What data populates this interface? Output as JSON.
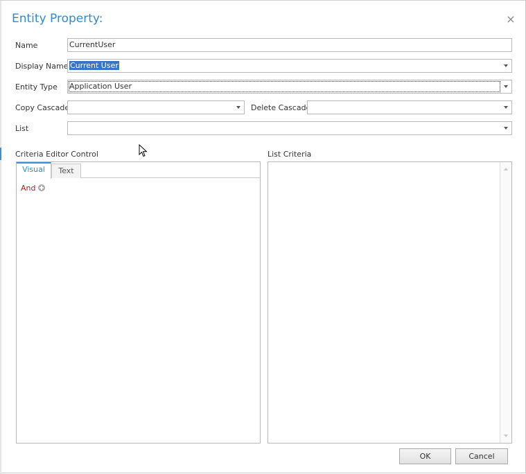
{
  "dialog": {
    "title": "Entity Property:",
    "close_glyph": "×"
  },
  "form": {
    "name_label": "Name",
    "name_value": "CurrentUser",
    "display_name_label": "Display Name",
    "display_name_value": "Current User",
    "entity_type_label": "Entity Type",
    "entity_type_value": "Application User",
    "copy_cascade_label": "Copy Cascade",
    "copy_cascade_value": "",
    "delete_cascade_label": "Delete Cascade",
    "delete_cascade_value": "",
    "list_label": "List",
    "list_value": ""
  },
  "criteria_editor": {
    "label": "Criteria Editor Control",
    "tabs": [
      {
        "label": "Visual",
        "active": true
      },
      {
        "label": "Text",
        "active": false
      }
    ],
    "root_operator": "And",
    "add_icon": "plus-circle-icon"
  },
  "list_criteria": {
    "label": "List Criteria"
  },
  "buttons": {
    "ok_label": "OK",
    "cancel_label": "Cancel"
  },
  "colors": {
    "title": "#2e8bd1",
    "accent": "#3d8fd1",
    "selection": "#3a74c8",
    "operator": "#b22222"
  }
}
